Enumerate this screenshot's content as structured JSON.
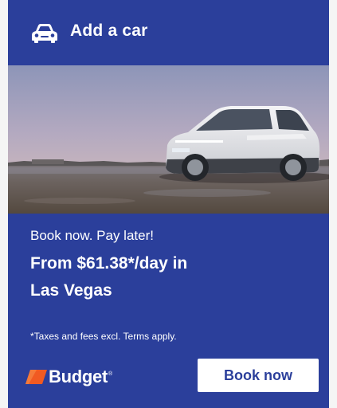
{
  "header": {
    "title": "Add a car",
    "icon": "car-icon"
  },
  "hero": {
    "image": "white electric SUV parked on wet beach at dusk"
  },
  "offer": {
    "tagline": "Book now. Pay later!",
    "price_line_1": "From $61.38*/day in",
    "price_line_2": "Las Vegas",
    "disclaimer": "*Taxes and fees excl. Terms apply."
  },
  "brand": {
    "name": "Budget",
    "trademark": "®",
    "accent_color": "#f15a22"
  },
  "cta": {
    "label": "Book now"
  },
  "colors": {
    "background": "#2b3f9b",
    "text": "#ffffff"
  }
}
